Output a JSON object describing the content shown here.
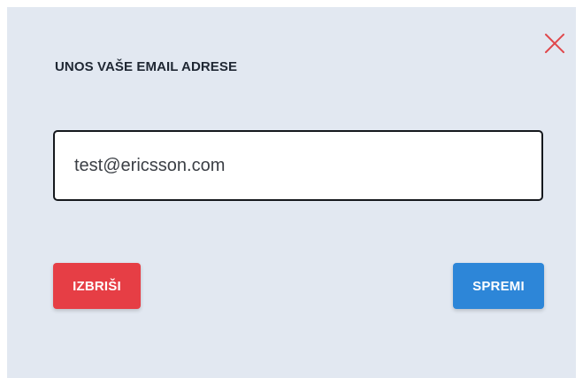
{
  "dialog": {
    "title": "UNOS VAŠE EMAIL ADRESE",
    "close_icon": "close-icon",
    "email": {
      "value": "test@ericsson.com",
      "placeholder": ""
    },
    "buttons": {
      "delete_label": "IZBRIŠI",
      "save_label": "SPREMI"
    }
  },
  "colors": {
    "background": "#e2e8f1",
    "close_icon": "#e0484c",
    "delete_button": "#e63e45",
    "save_button": "#2d86d8",
    "title_text": "#1f2733",
    "input_border": "#15181d"
  }
}
